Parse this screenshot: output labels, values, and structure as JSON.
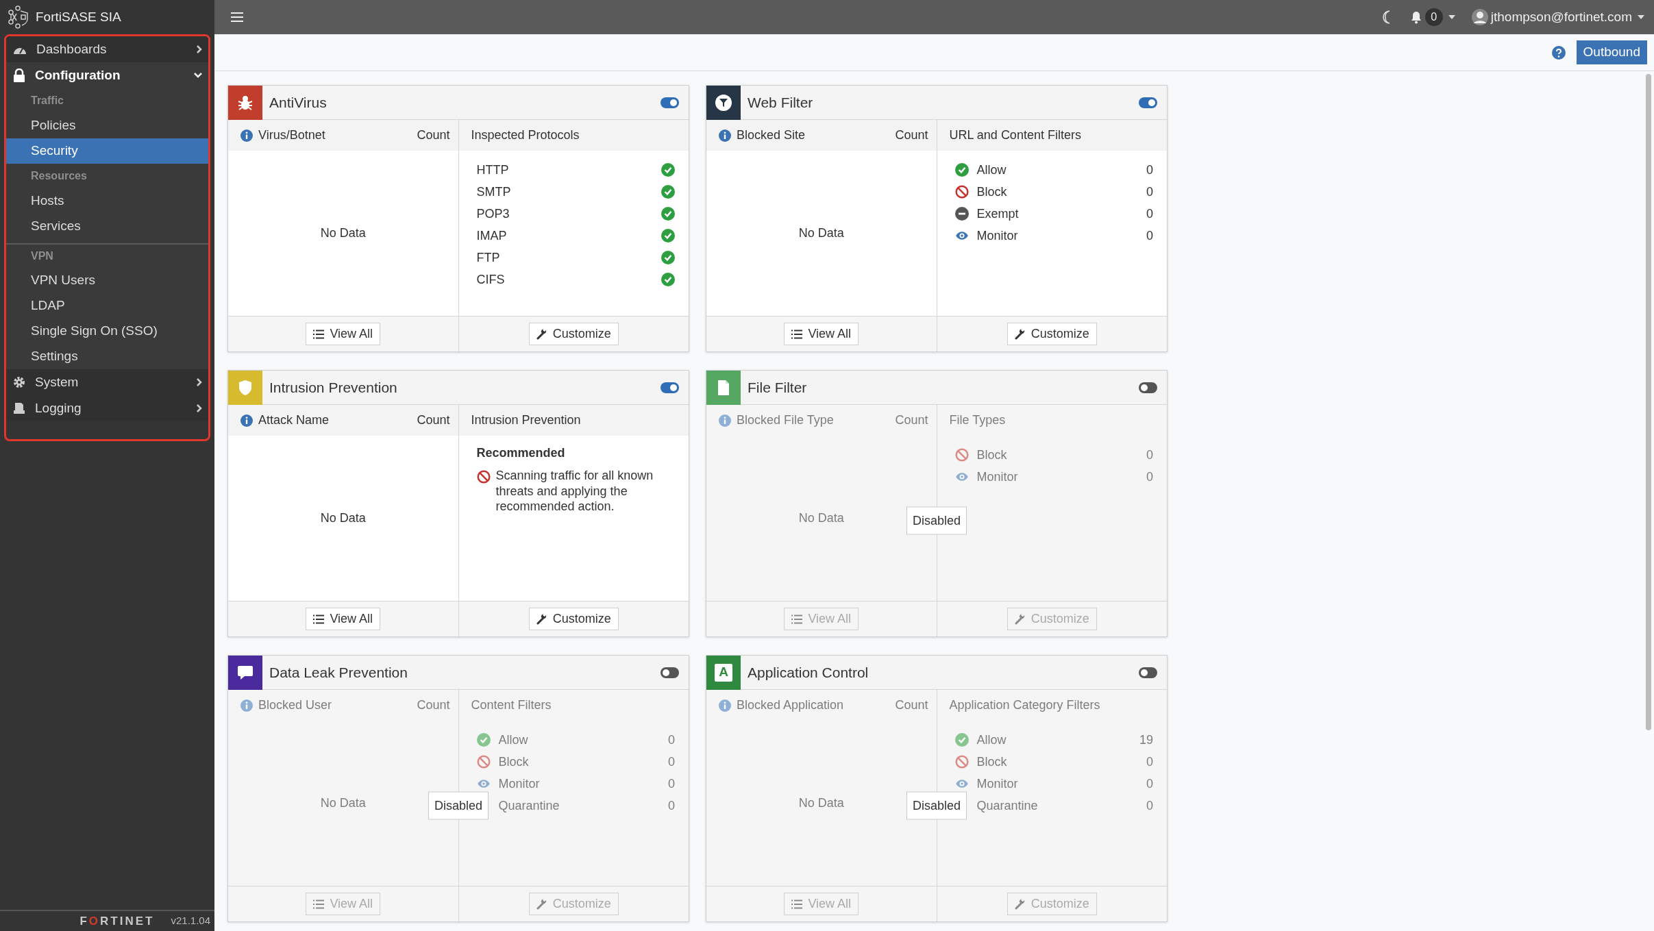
{
  "app": {
    "title": "FortiSASE SIA"
  },
  "sidebar": {
    "items": [
      {
        "kind": "menu",
        "label": "Dashboards",
        "expanded": false
      },
      {
        "kind": "menu",
        "label": "Configuration",
        "expanded": true,
        "children": [
          {
            "kind": "header",
            "label": "Traffic",
            "divider": false
          },
          {
            "kind": "link",
            "label": "Policies",
            "selected": false
          },
          {
            "kind": "link",
            "label": "Security",
            "selected": true
          },
          {
            "kind": "header",
            "label": "Resources",
            "divider": false
          },
          {
            "kind": "link",
            "label": "Hosts",
            "selected": false
          },
          {
            "kind": "link",
            "label": "Services",
            "selected": false
          },
          {
            "kind": "header",
            "label": "VPN",
            "divider": true
          },
          {
            "kind": "link",
            "label": "VPN Users",
            "selected": false
          },
          {
            "kind": "link",
            "label": "LDAP",
            "selected": false
          },
          {
            "kind": "link",
            "label": "Single Sign On (SSO)",
            "selected": false
          },
          {
            "kind": "link",
            "label": "Settings",
            "selected": false
          }
        ]
      },
      {
        "kind": "menu",
        "label": "System",
        "expanded": false
      },
      {
        "kind": "menu",
        "label": "Logging",
        "expanded": false
      }
    ],
    "footer": {
      "logo": "FORTINET",
      "version": "v21.1.04"
    }
  },
  "topbar": {
    "notifications": "0",
    "user": "jthompson@fortinet.com"
  },
  "toolbar": {
    "button": "Outbound"
  },
  "cards": [
    {
      "title": "AntiVirus",
      "color": "#c13d2c",
      "enabled": true,
      "left": {
        "column": "Virus/Botnet",
        "count": "Count",
        "empty": "No Data"
      },
      "right": {
        "column": "Inspected Protocols",
        "kind": "protocols",
        "items": [
          {
            "label": "HTTP",
            "kind": "allow"
          },
          {
            "label": "SMTP",
            "kind": "allow"
          },
          {
            "label": "POP3",
            "kind": "allow"
          },
          {
            "label": "IMAP",
            "kind": "allow"
          },
          {
            "label": "FTP",
            "kind": "allow"
          },
          {
            "label": "CIFS",
            "kind": "allow"
          }
        ]
      },
      "buttons": [
        "View All",
        "Customize"
      ]
    },
    {
      "title": "Web Filter",
      "color": "#273646",
      "enabled": true,
      "left": {
        "column": "Blocked Site",
        "count": "Count",
        "empty": "No Data"
      },
      "right": {
        "column": "URL and Content Filters",
        "kind": "filters",
        "items": [
          {
            "label": "Allow",
            "kind": "allow",
            "value": "0"
          },
          {
            "label": "Block",
            "kind": "block",
            "value": "0"
          },
          {
            "label": "Exempt",
            "kind": "exempt",
            "value": "0"
          },
          {
            "label": "Monitor",
            "kind": "monitor",
            "value": "0"
          }
        ]
      },
      "buttons": [
        "View All",
        "Customize"
      ]
    },
    {
      "title": "Intrusion Prevention",
      "color": "#d6bb2e",
      "enabled": true,
      "left": {
        "column": "Attack Name",
        "count": "Count",
        "empty": "No Data"
      },
      "right": {
        "column": "Intrusion Prevention",
        "kind": "notes",
        "heading": "Recommended",
        "items": [
          {
            "label": "Scanning traffic for all known threats and applying the recommended action.",
            "kind": "block"
          }
        ]
      },
      "buttons": [
        "View All",
        "Customize"
      ]
    },
    {
      "title": "File Filter",
      "color": "#55a861",
      "enabled": false,
      "overlay": "Disabled",
      "left": {
        "column": "Blocked File Type",
        "count": "Count",
        "empty": "No Data"
      },
      "right": {
        "column": "File Types",
        "kind": "filters",
        "items": [
          {
            "label": "Block",
            "kind": "block",
            "value": "0"
          },
          {
            "label": "Monitor",
            "kind": "monitor",
            "value": "0"
          }
        ]
      },
      "buttons": [
        "View All",
        "Customize"
      ]
    },
    {
      "title": "Data Leak Prevention",
      "color": "#4a2a9c",
      "enabled": false,
      "overlay": "Disabled",
      "left": {
        "column": "Blocked User",
        "count": "Count",
        "empty": "No Data"
      },
      "right": {
        "column": "Content Filters",
        "kind": "filters",
        "items": [
          {
            "label": "Allow",
            "kind": "allow",
            "value": "0"
          },
          {
            "label": "Block",
            "kind": "block",
            "value": "0"
          },
          {
            "label": "Monitor",
            "kind": "monitor",
            "value": "0"
          },
          {
            "label": "Quarantine",
            "kind": "plain",
            "value": "0"
          }
        ]
      },
      "buttons": [
        "View All",
        "Customize"
      ]
    },
    {
      "title": "Application Control",
      "color": "#2f8a3f",
      "icon_text": "A",
      "enabled": false,
      "overlay": "Disabled",
      "left": {
        "column": "Blocked Application",
        "count": "Count",
        "empty": "No Data"
      },
      "right": {
        "column": "Application Category Filters",
        "kind": "filters",
        "items": [
          {
            "label": "Allow",
            "kind": "allow",
            "value": "19"
          },
          {
            "label": "Block",
            "kind": "block",
            "value": "0"
          },
          {
            "label": "Monitor",
            "kind": "monitor",
            "value": "0"
          },
          {
            "label": "Quarantine",
            "kind": "plain",
            "value": "0"
          }
        ]
      },
      "buttons": [
        "View All",
        "Customize"
      ]
    }
  ]
}
